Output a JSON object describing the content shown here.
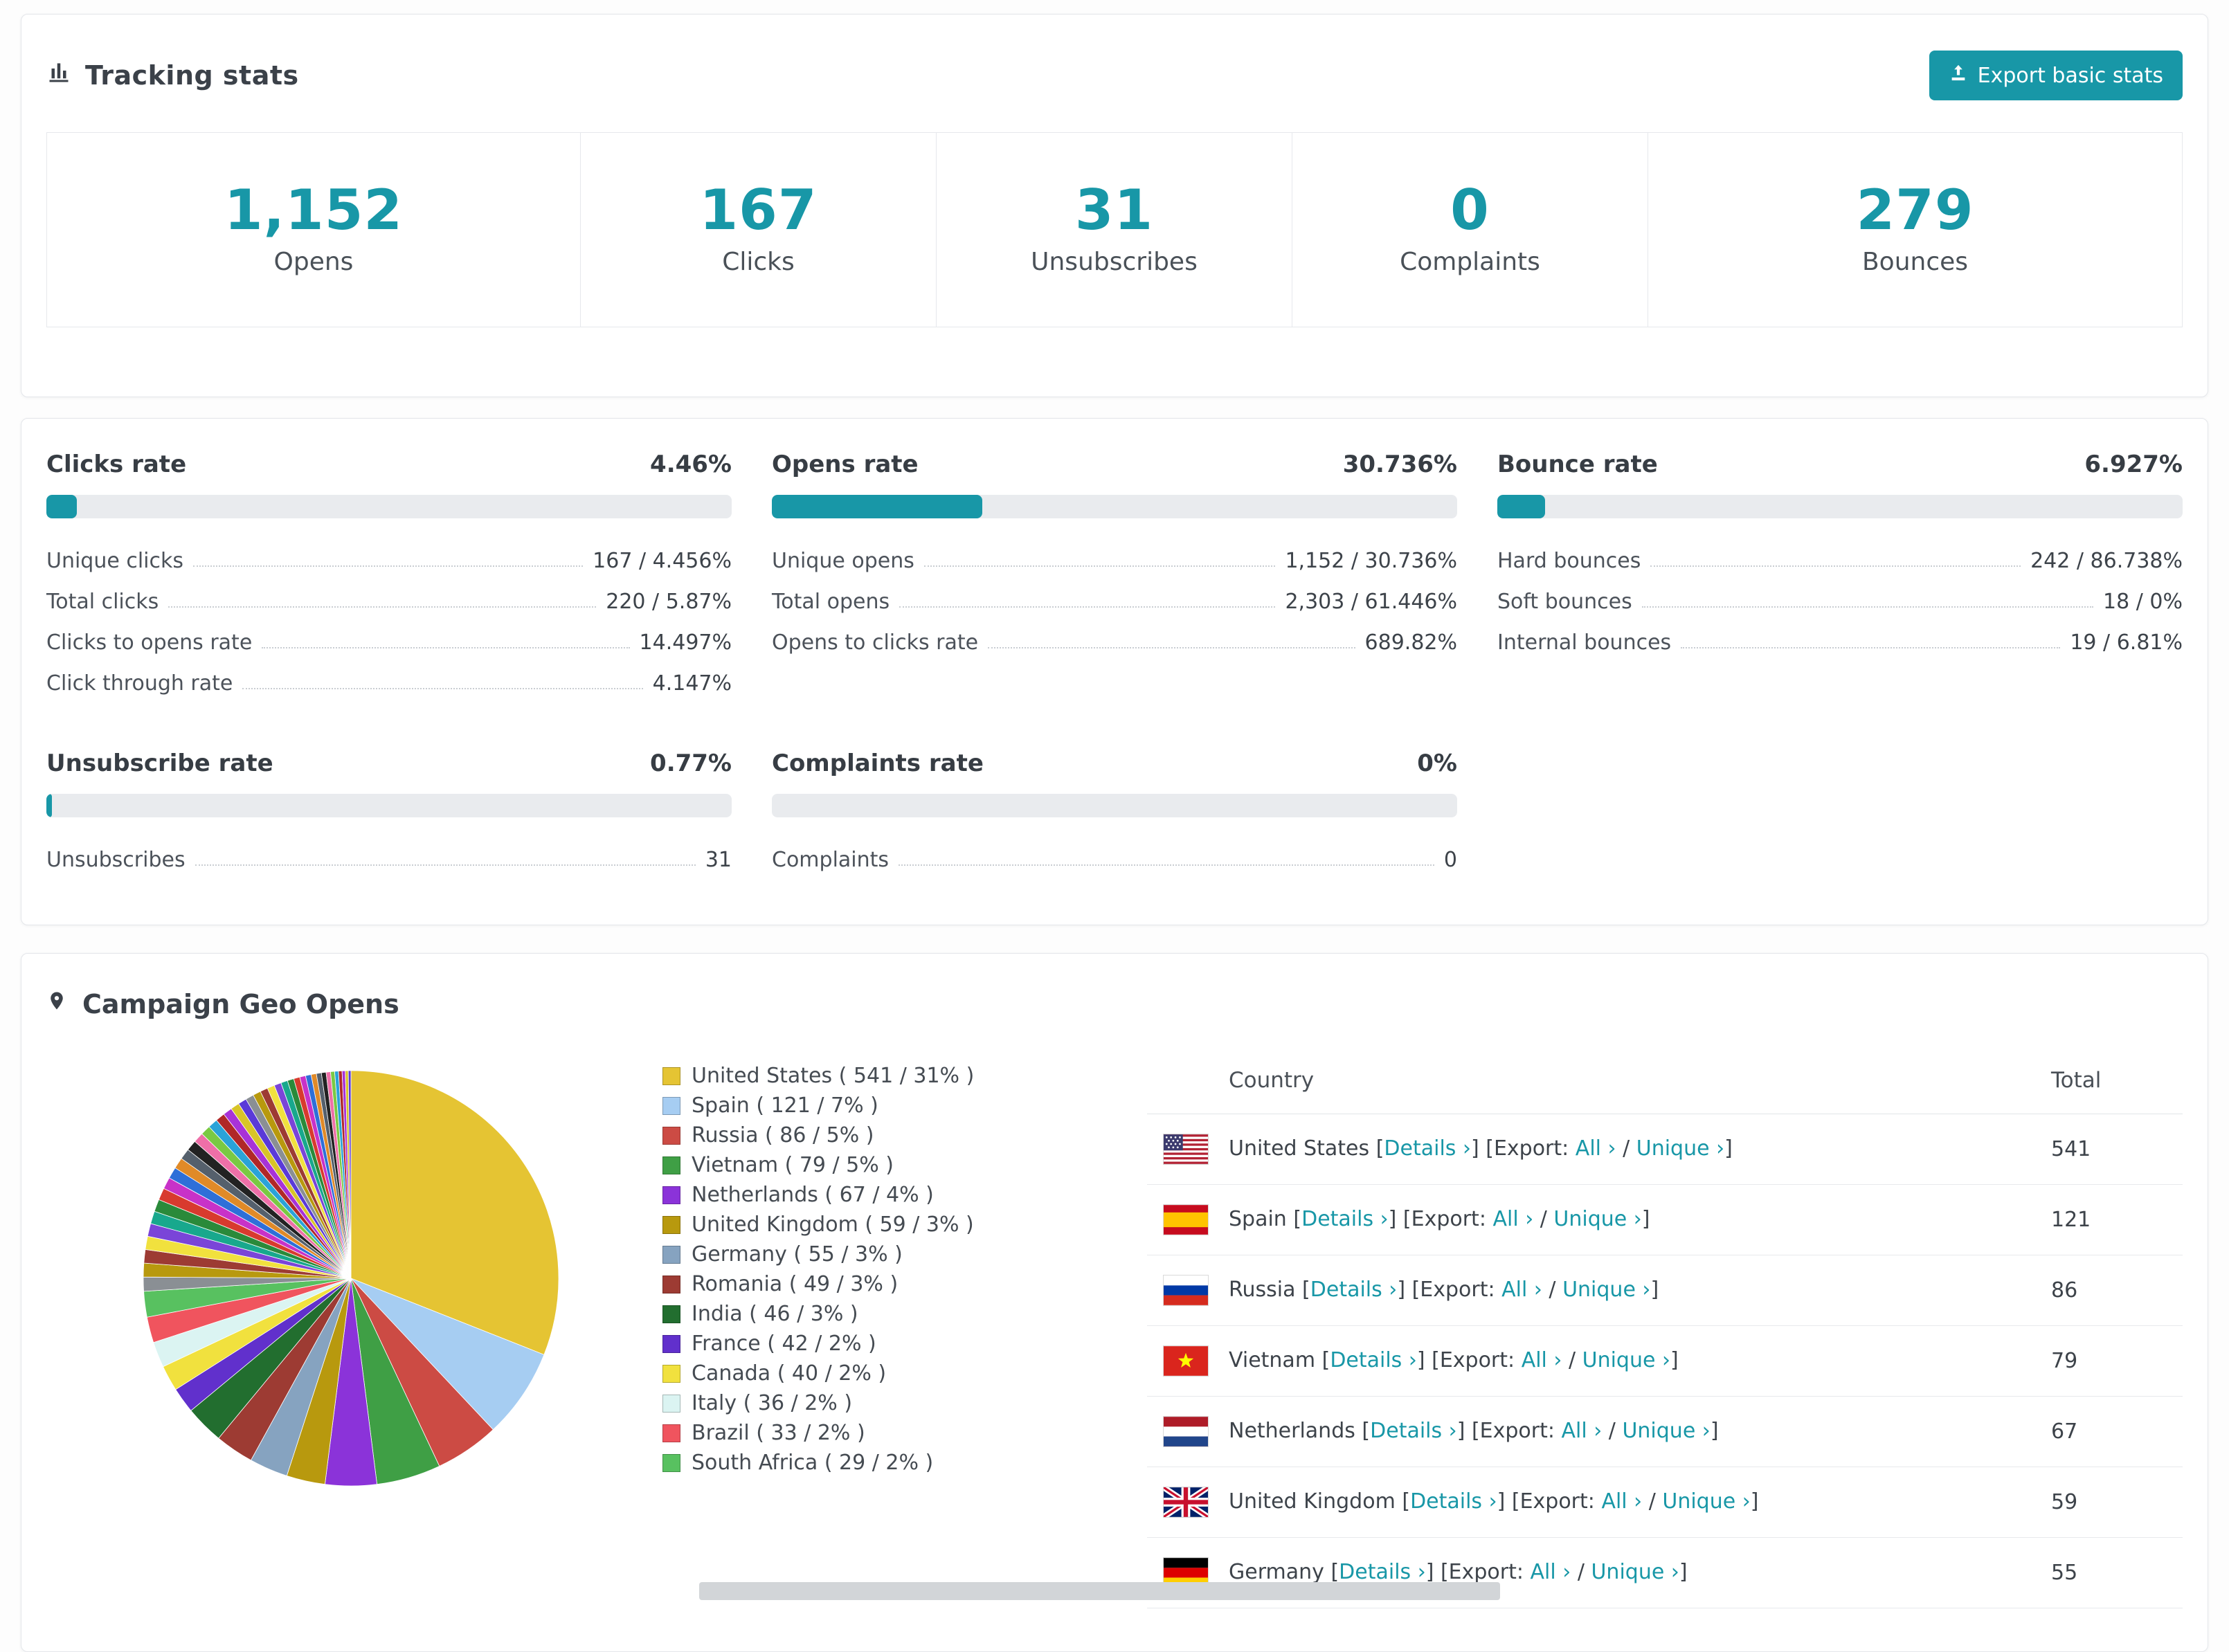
{
  "accent": "#1897a7",
  "tracking": {
    "title": "Tracking stats",
    "export_button": "Export basic stats",
    "stats": [
      {
        "value": "1,152",
        "label": "Opens"
      },
      {
        "value": "167",
        "label": "Clicks"
      },
      {
        "value": "31",
        "label": "Unsubscribes"
      },
      {
        "value": "0",
        "label": "Complaints"
      },
      {
        "value": "279",
        "label": "Bounces"
      }
    ]
  },
  "rates": [
    {
      "title": "Clicks rate",
      "percent": "4.46%",
      "fill": 4.46,
      "rows": [
        {
          "label": "Unique clicks",
          "value": "167 / 4.456%"
        },
        {
          "label": "Total clicks",
          "value": "220 / 5.87%"
        },
        {
          "label": "Clicks to opens rate",
          "value": "14.497%"
        },
        {
          "label": "Click through rate",
          "value": "4.147%"
        }
      ]
    },
    {
      "title": "Opens rate",
      "percent": "30.736%",
      "fill": 30.736,
      "rows": [
        {
          "label": "Unique opens",
          "value": "1,152 / 30.736%"
        },
        {
          "label": "Total opens",
          "value": "2,303 / 61.446%"
        },
        {
          "label": "Opens to clicks rate",
          "value": "689.82%"
        }
      ]
    },
    {
      "title": "Bounce rate",
      "percent": "6.927%",
      "fill": 6.927,
      "rows": [
        {
          "label": "Hard bounces",
          "value": "242 / 86.738%"
        },
        {
          "label": "Soft bounces",
          "value": "18 / 0%"
        },
        {
          "label": "Internal bounces",
          "value": "19 / 6.81%"
        }
      ]
    },
    {
      "title": "Unsubscribe rate",
      "percent": "0.77%",
      "fill": 0.77,
      "rows": [
        {
          "label": "Unsubscribes",
          "value": "31"
        }
      ]
    },
    {
      "title": "Complaints rate",
      "percent": "0%",
      "fill": 0,
      "rows": [
        {
          "label": "Complaints",
          "value": "0"
        }
      ]
    }
  ],
  "geo": {
    "title": "Campaign Geo Opens",
    "table": {
      "headers": {
        "country": "Country",
        "total": "Total"
      },
      "link_labels": {
        "details": "Details ›",
        "export_prefix": "[Export:",
        "all": "All ›",
        "unique": "Unique ›"
      },
      "rows": [
        {
          "country": "United States",
          "flag": "us",
          "total": "541"
        },
        {
          "country": "Spain",
          "flag": "es",
          "total": "121"
        },
        {
          "country": "Russia",
          "flag": "ru",
          "total": "86"
        },
        {
          "country": "Vietnam",
          "flag": "vn",
          "total": "79"
        },
        {
          "country": "Netherlands",
          "flag": "nl",
          "total": "67"
        },
        {
          "country": "United Kingdom",
          "flag": "gb",
          "total": "59"
        },
        {
          "country": "Germany",
          "flag": "de",
          "total": "55"
        }
      ]
    }
  },
  "chart_data": {
    "type": "pie",
    "title": "Campaign Geo Opens",
    "legend_position": "right",
    "segments": [
      {
        "label": "United States",
        "value": 541,
        "percent": 31,
        "color": "#e5c433"
      },
      {
        "label": "Spain",
        "value": 121,
        "percent": 7,
        "color": "#a6cdf2"
      },
      {
        "label": "Russia",
        "value": 86,
        "percent": 5,
        "color": "#cc4b44"
      },
      {
        "label": "Vietnam",
        "value": 79,
        "percent": 5,
        "color": "#3f9f45"
      },
      {
        "label": "Netherlands",
        "value": 67,
        "percent": 4,
        "color": "#8b33d9"
      },
      {
        "label": "United Kingdom",
        "value": 59,
        "percent": 3,
        "color": "#b8990e"
      },
      {
        "label": "Germany",
        "value": 55,
        "percent": 3,
        "color": "#86a3c0"
      },
      {
        "label": "Romania",
        "value": 49,
        "percent": 3,
        "color": "#9d3b33"
      },
      {
        "label": "India",
        "value": 46,
        "percent": 3,
        "color": "#226e2f"
      },
      {
        "label": "France",
        "value": 42,
        "percent": 2,
        "color": "#6130cc"
      },
      {
        "label": "Canada",
        "value": 40,
        "percent": 2,
        "color": "#f1e13e"
      },
      {
        "label": "Italy",
        "value": 36,
        "percent": 2,
        "color": "#dbf4f2"
      },
      {
        "label": "Brazil",
        "value": 33,
        "percent": 2,
        "color": "#f0545e"
      },
      {
        "label": "South Africa",
        "value": 29,
        "percent": 2,
        "color": "#58c160"
      }
    ],
    "unlabeled_remainder_percent": 26
  }
}
